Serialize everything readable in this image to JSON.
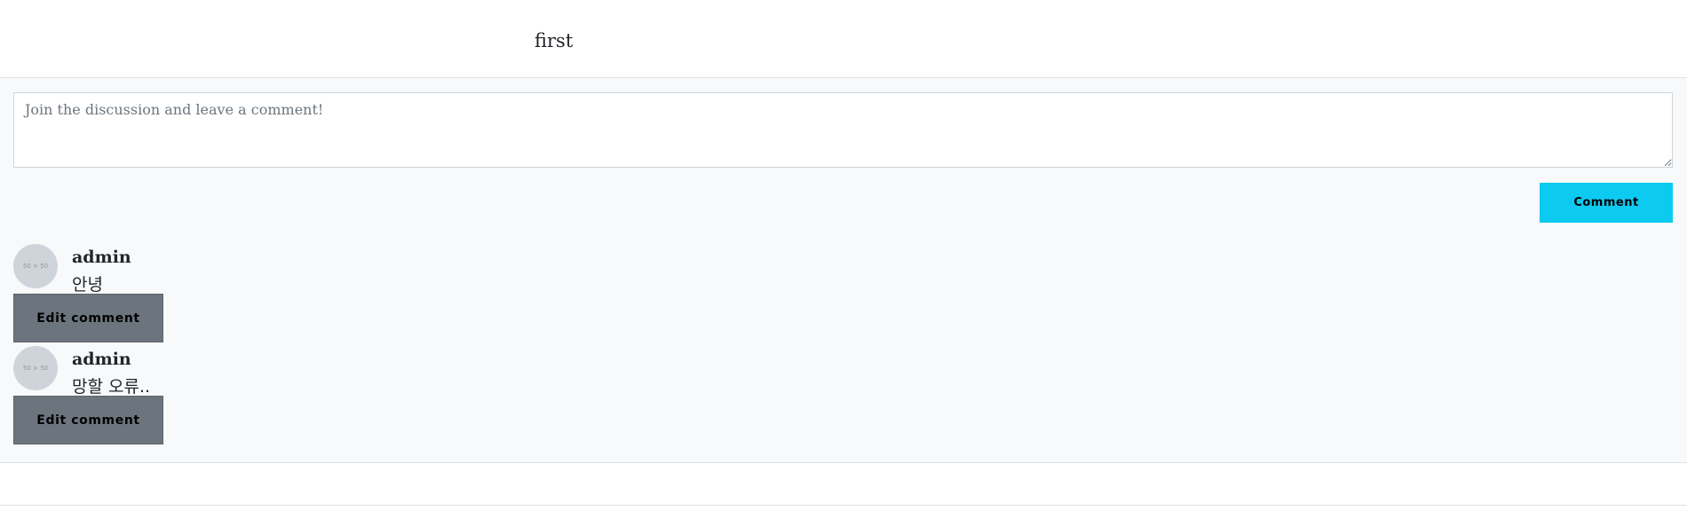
{
  "post": {
    "title": "first"
  },
  "comment_form": {
    "placeholder": "Join the discussion and leave a comment!",
    "value": "",
    "submit_label": "Comment"
  },
  "comments": [
    {
      "avatar_text": "50 × 50",
      "author": "admin",
      "text": "안녕",
      "edit_label": "Edit comment"
    },
    {
      "avatar_text": "50 × 50",
      "author": "admin",
      "text": "망할 오류..",
      "edit_label": "Edit comment"
    }
  ],
  "colors": {
    "accent": "#0dcaf0",
    "secondary": "#6c757d",
    "section_bg": "#f8f9fa",
    "avatar": "#ced4da"
  }
}
